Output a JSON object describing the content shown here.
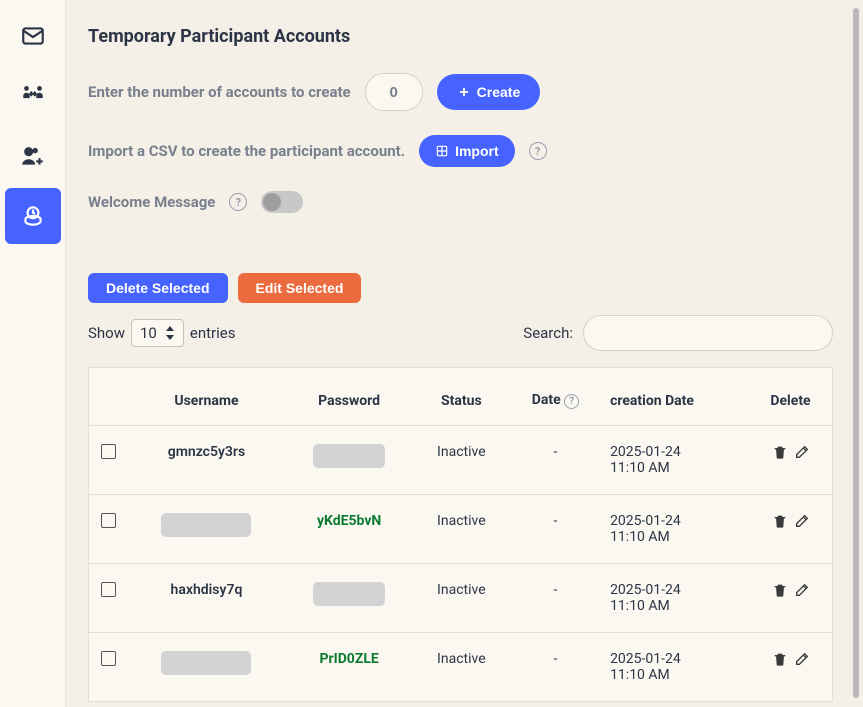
{
  "title": "Temporary Participant Accounts",
  "create": {
    "label": "Enter the number of accounts to create",
    "value": "0",
    "button": "Create"
  },
  "import": {
    "label": "Import a CSV to create the participant account.",
    "button": "Import"
  },
  "welcome": {
    "label": "Welcome Message"
  },
  "buttons": {
    "delete_selected": "Delete Selected",
    "edit_selected": "Edit Selected"
  },
  "table_controls": {
    "show": "Show",
    "entries": "entries",
    "page_size": "10",
    "search_label": "Search:"
  },
  "columns": {
    "username": "Username",
    "password": "Password",
    "status": "Status",
    "date": "Date",
    "creation_date": "creation Date",
    "delete": "Delete"
  },
  "rows": [
    {
      "username": "gmnzc5y3rs",
      "username_redacted": false,
      "password": "",
      "password_redacted": true,
      "status": "Inactive",
      "date": "-",
      "creation_line1": "2025-01-24",
      "creation_line2": "11:10 AM"
    },
    {
      "username": "",
      "username_redacted": true,
      "password": "yKdE5bvN",
      "password_redacted": false,
      "status": "Inactive",
      "date": "-",
      "creation_line1": "2025-01-24",
      "creation_line2": "11:10 AM"
    },
    {
      "username": "haxhdisy7q",
      "username_redacted": false,
      "password": "",
      "password_redacted": true,
      "status": "Inactive",
      "date": "-",
      "creation_line1": "2025-01-24",
      "creation_line2": "11:10 AM"
    },
    {
      "username": "",
      "username_redacted": true,
      "password": "PrID0ZLE",
      "password_redacted": false,
      "status": "Inactive",
      "date": "-",
      "creation_line1": "2025-01-24",
      "creation_line2": "11:10 AM"
    }
  ]
}
